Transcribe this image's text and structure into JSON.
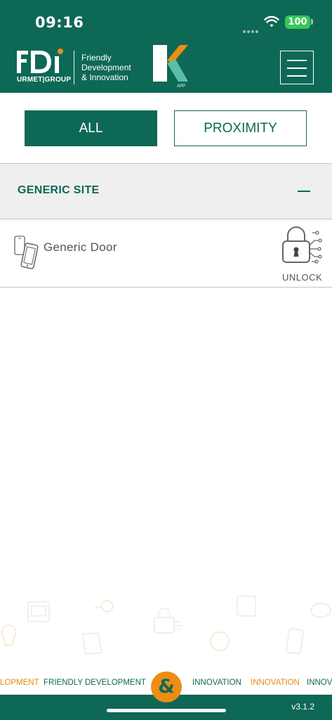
{
  "status_bar": {
    "time": "09:16",
    "battery": "100"
  },
  "header": {
    "logo_text": "FDi",
    "logo_group": "URMET|GROUP",
    "tagline": [
      "Friendly",
      "Development",
      "& Innovation"
    ],
    "app_logo_caption": "APP",
    "menu_icon": "hamburger-menu-icon"
  },
  "filters": {
    "all_label": "ALL",
    "proximity_label": "PROXIMITY",
    "active": "ALL"
  },
  "site": {
    "name": "GENERIC SITE",
    "collapse_symbol": "—",
    "doors": [
      {
        "name": "Generic Door",
        "action_label": "UNLOCK",
        "icon": "phones-icon"
      }
    ]
  },
  "ticker": {
    "items": [
      {
        "text": "LOPMENT",
        "color": "orange"
      },
      {
        "text": "FRIENDLY DEVELOPMENT",
        "color": "green"
      },
      {
        "text": "INNOVATION",
        "color": "green"
      },
      {
        "text": "INNOVATION",
        "color": "orange"
      },
      {
        "text": "INNOV",
        "color": "green"
      }
    ],
    "center_symbol": "&"
  },
  "footer": {
    "version": "v3.1.2"
  },
  "colors": {
    "brand_green": "#0e6856",
    "brand_orange": "#ec8d14",
    "section_bg": "#efefef"
  }
}
